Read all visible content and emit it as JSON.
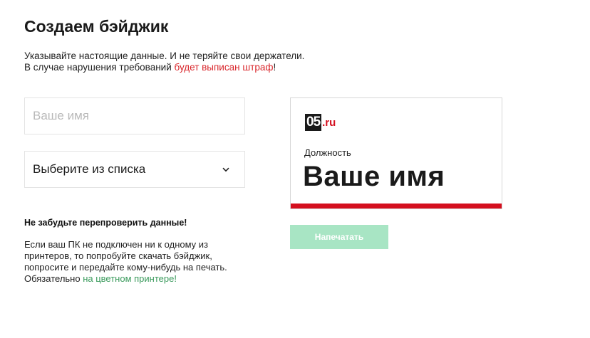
{
  "page": {
    "title": "Создаем бэйджик",
    "intro_line1": "Указывайте настоящие данные. И не теряйте свои держатели.",
    "intro_line2_prefix": "В случае нарушения требований ",
    "intro_line2_red": "будет выписан штраф",
    "intro_line2_suffix": "!"
  },
  "form": {
    "name_placeholder": "Ваше имя",
    "name_value": "",
    "select_value": "Выберите из списка",
    "select_icon": "chevron-down-icon"
  },
  "notice": {
    "heading": "Не забудьте перепроверить данные!",
    "body_line1": "Если ваш ПК не подключен ни к одному из",
    "body_line2": "принтеров, то попробуйте скачать бэйджик,",
    "body_line3": "попросите и передайте кому-нибудь на печать.",
    "body_line4_prefix": "Обязательно ",
    "body_line4_green": "на цветном принтере!"
  },
  "badge": {
    "logo_number": "05",
    "logo_domain": ".ru",
    "position": "Должность",
    "name": "Ваше имя"
  },
  "actions": {
    "print_label": "Напечатать"
  },
  "colors": {
    "accent_red": "#d40f1e",
    "accent_green": "#3a9a5c",
    "button_green_disabled": "#a8e5c4"
  }
}
